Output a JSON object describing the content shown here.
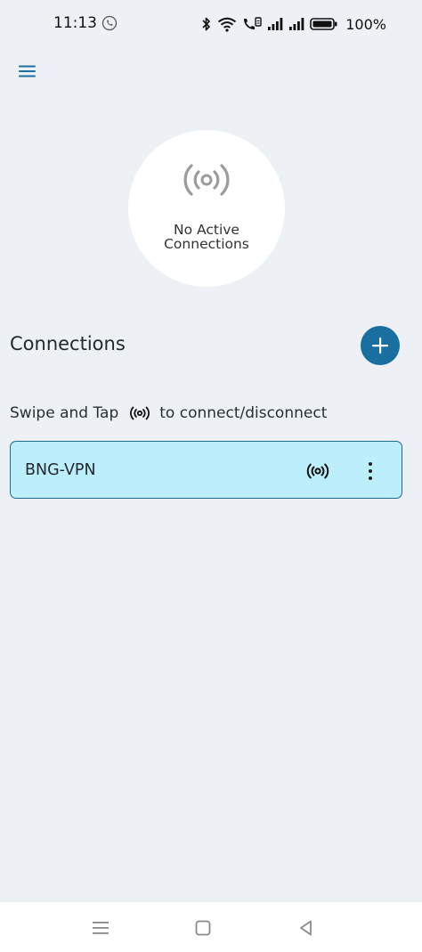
{
  "status_bar": {
    "time": "11:13",
    "battery_percent": "100%",
    "icons": [
      "call-icon",
      "bluetooth-icon",
      "wifi-icon",
      "volte-icon",
      "signal-icon",
      "signal-icon",
      "battery-icon"
    ]
  },
  "header": {
    "menu_icon": "hamburger-menu-icon"
  },
  "status_circle": {
    "line1": "No Active",
    "line2": "Connections",
    "icon": "broadcast-icon"
  },
  "connections": {
    "title": "Connections",
    "add_icon": "plus-icon",
    "hint_before": "Swipe and Tap",
    "hint_after": "to connect/disconnect",
    "items": [
      {
        "name": "BNG-VPN",
        "toggle_icon": "broadcast-icon",
        "menu_icon": "more-vertical-icon"
      }
    ]
  },
  "nav_bar": {
    "icons": [
      "recent-apps-icon",
      "home-icon",
      "back-icon"
    ]
  },
  "colors": {
    "background": "#edf1f5",
    "accent": "#1a6fa1",
    "card_fill": "#bdeefc",
    "card_border": "#1d6a94"
  }
}
